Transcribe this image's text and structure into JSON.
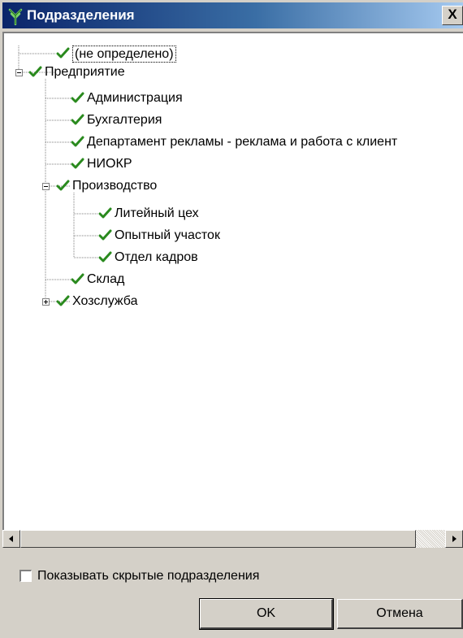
{
  "window": {
    "title": "Подразделения",
    "close_label": "X"
  },
  "tree": {
    "items": [
      {
        "label": "(не определено)",
        "checked": true,
        "selected": true
      },
      {
        "label": "Предприятие",
        "checked": true,
        "expanded": true
      },
      {
        "label": "Администрация",
        "checked": true
      },
      {
        "label": "Бухгалтерия",
        "checked": true
      },
      {
        "label": "Департамент рекламы - реклама и работа с клиент",
        "checked": true
      },
      {
        "label": "НИОКР",
        "checked": true
      },
      {
        "label": "Производство",
        "checked": true,
        "expanded": true
      },
      {
        "label": "Литейный цех",
        "checked": true
      },
      {
        "label": "Опытный участок",
        "checked": true
      },
      {
        "label": "Отдел кадров",
        "checked": true
      },
      {
        "label": "Склад",
        "checked": true
      },
      {
        "label": "Хозслужба",
        "checked": true,
        "expanded": false
      }
    ]
  },
  "options": {
    "show_hidden_label": "Показывать скрытые подразделения",
    "show_hidden_checked": false
  },
  "buttons": {
    "ok_label": "OK",
    "cancel_label": "Отмена"
  },
  "colors": {
    "title_gradient_start": "#0a246a",
    "title_gradient_end": "#a6caf0",
    "check_green": "#2a8a1e",
    "window_face": "#d4d0c8"
  }
}
